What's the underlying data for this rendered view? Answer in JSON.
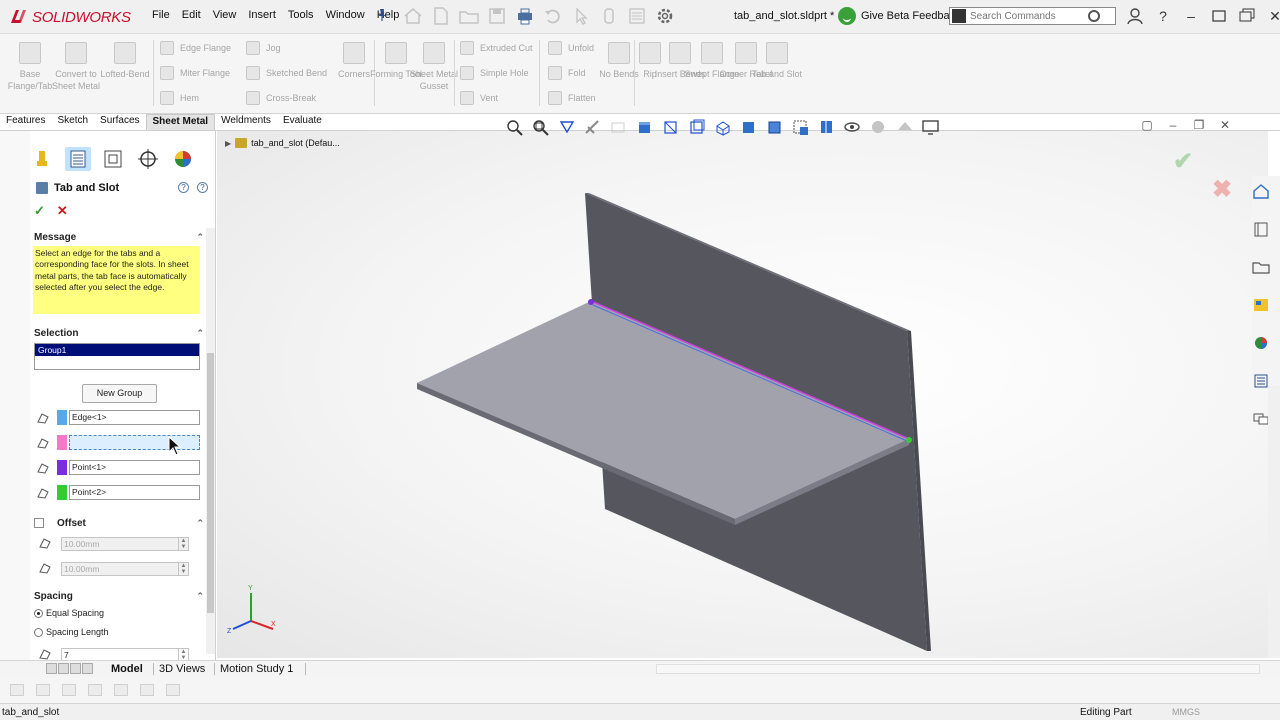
{
  "app": {
    "brand_ds": "3S",
    "brand_solid": "SOLID",
    "brand_works": "WORKS",
    "document_title": "tab_and_slot.sldprt *"
  },
  "menu": [
    "File",
    "Edit",
    "View",
    "Insert",
    "Tools",
    "Window",
    "Help"
  ],
  "header": {
    "beta_feedback": "Give Beta Feedback",
    "search_placeholder": "Search Commands"
  },
  "ribbon": {
    "big": [
      {
        "label": "Base Flange/Tab",
        "icon": "base-flange-icon"
      },
      {
        "label": "Convert to Sheet Metal",
        "icon": "convert-sheet-metal-icon"
      },
      {
        "label": "Lofted-Bend",
        "icon": "lofted-bend-icon"
      },
      {
        "label": "Corners",
        "icon": "corners-icon"
      },
      {
        "label": "Forming Tool",
        "icon": "forming-tool-icon"
      },
      {
        "label": "Sheet Metal Gusset",
        "icon": "gusset-icon"
      },
      {
        "label": "No Bends",
        "icon": "no-bends-icon"
      },
      {
        "label": "Rip",
        "icon": "rip-icon"
      },
      {
        "label": "Insert Bends",
        "icon": "insert-bends-icon"
      },
      {
        "label": "Swept Flange",
        "icon": "swept-flange-icon"
      },
      {
        "label": "Corner Relief",
        "icon": "corner-relief-icon"
      },
      {
        "label": "Tab and Slot",
        "icon": "tab-and-slot-icon"
      }
    ],
    "small": [
      {
        "label": "Edge Flange",
        "icon": "edge-flange-icon"
      },
      {
        "label": "Miter Flange",
        "icon": "miter-flange-icon"
      },
      {
        "label": "Hem",
        "icon": "hem-icon"
      },
      {
        "label": "Jog",
        "icon": "jog-icon"
      },
      {
        "label": "Sketched Bend",
        "icon": "sketched-bend-icon"
      },
      {
        "label": "Cross-Break",
        "icon": "cross-break-icon"
      },
      {
        "label": "Extruded Cut",
        "icon": "extruded-cut-icon"
      },
      {
        "label": "Simple Hole",
        "icon": "simple-hole-icon"
      },
      {
        "label": "Vent",
        "icon": "vent-icon"
      },
      {
        "label": "Unfold",
        "icon": "unfold-icon"
      },
      {
        "label": "Fold",
        "icon": "fold-icon"
      },
      {
        "label": "Flatten",
        "icon": "flatten-icon"
      }
    ]
  },
  "command_tabs": [
    "Features",
    "Sketch",
    "Surfaces",
    "Sheet Metal",
    "Weldments",
    "Evaluate"
  ],
  "active_command_tab": "Sheet Metal",
  "property_manager": {
    "title": "Tab and Slot",
    "message_header": "Message",
    "message_text": "Select an edge for the tabs and a corresponding face for the slots. In sheet metal parts, the tab face is automatically selected after you select the edge.",
    "selection_header": "Selection",
    "group_item": "Group1",
    "new_group_button": "New Group",
    "selection_fields": [
      {
        "value": "Edge<1>",
        "color": "#5aa9e6",
        "active": false
      },
      {
        "value": "",
        "color": "#f07ac8",
        "active": true
      },
      {
        "value": "Point<1>",
        "color": "#7b2de0",
        "active": false
      },
      {
        "value": "Point<2>",
        "color": "#33cc33",
        "active": false
      }
    ],
    "offset_header": "Offset",
    "offset_start": "10.00mm",
    "offset_end": "10.00mm",
    "spacing_header": "Spacing",
    "spacing_options": [
      {
        "label": "Equal Spacing",
        "selected": true
      },
      {
        "label": "Spacing Length",
        "selected": false
      }
    ],
    "spacing_count": "7"
  },
  "viewport": {
    "tree_node": "tab_and_slot  (Defau..."
  },
  "bottom_tabs": [
    "Model",
    "3D Views",
    "Motion Study 1"
  ],
  "active_bottom_tab": "Model",
  "status": {
    "left": "tab_and_slot",
    "mode": "Editing Part",
    "units": "MMGS"
  },
  "colors": {
    "brand": "#c8102e",
    "message_bg": "#ffff80",
    "selection_bg": "#000e78",
    "part_dark": "#56565f",
    "part_light": "#a2a2ad",
    "edge_highlight": "#d040e0"
  }
}
